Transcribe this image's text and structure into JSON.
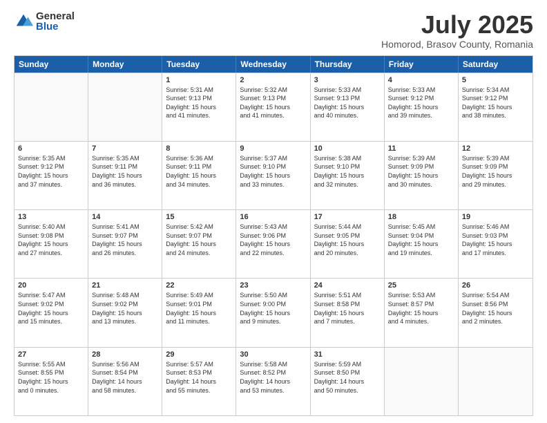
{
  "header": {
    "logo_general": "General",
    "logo_blue": "Blue",
    "title": "July 2025",
    "subtitle": "Homorod, Brasov County, Romania"
  },
  "weekdays": [
    "Sunday",
    "Monday",
    "Tuesday",
    "Wednesday",
    "Thursday",
    "Friday",
    "Saturday"
  ],
  "weeks": [
    [
      {
        "day": "",
        "info": ""
      },
      {
        "day": "",
        "info": ""
      },
      {
        "day": "1",
        "info": "Sunrise: 5:31 AM\nSunset: 9:13 PM\nDaylight: 15 hours\nand 41 minutes."
      },
      {
        "day": "2",
        "info": "Sunrise: 5:32 AM\nSunset: 9:13 PM\nDaylight: 15 hours\nand 41 minutes."
      },
      {
        "day": "3",
        "info": "Sunrise: 5:33 AM\nSunset: 9:13 PM\nDaylight: 15 hours\nand 40 minutes."
      },
      {
        "day": "4",
        "info": "Sunrise: 5:33 AM\nSunset: 9:12 PM\nDaylight: 15 hours\nand 39 minutes."
      },
      {
        "day": "5",
        "info": "Sunrise: 5:34 AM\nSunset: 9:12 PM\nDaylight: 15 hours\nand 38 minutes."
      }
    ],
    [
      {
        "day": "6",
        "info": "Sunrise: 5:35 AM\nSunset: 9:12 PM\nDaylight: 15 hours\nand 37 minutes."
      },
      {
        "day": "7",
        "info": "Sunrise: 5:35 AM\nSunset: 9:11 PM\nDaylight: 15 hours\nand 36 minutes."
      },
      {
        "day": "8",
        "info": "Sunrise: 5:36 AM\nSunset: 9:11 PM\nDaylight: 15 hours\nand 34 minutes."
      },
      {
        "day": "9",
        "info": "Sunrise: 5:37 AM\nSunset: 9:10 PM\nDaylight: 15 hours\nand 33 minutes."
      },
      {
        "day": "10",
        "info": "Sunrise: 5:38 AM\nSunset: 9:10 PM\nDaylight: 15 hours\nand 32 minutes."
      },
      {
        "day": "11",
        "info": "Sunrise: 5:39 AM\nSunset: 9:09 PM\nDaylight: 15 hours\nand 30 minutes."
      },
      {
        "day": "12",
        "info": "Sunrise: 5:39 AM\nSunset: 9:09 PM\nDaylight: 15 hours\nand 29 minutes."
      }
    ],
    [
      {
        "day": "13",
        "info": "Sunrise: 5:40 AM\nSunset: 9:08 PM\nDaylight: 15 hours\nand 27 minutes."
      },
      {
        "day": "14",
        "info": "Sunrise: 5:41 AM\nSunset: 9:07 PM\nDaylight: 15 hours\nand 26 minutes."
      },
      {
        "day": "15",
        "info": "Sunrise: 5:42 AM\nSunset: 9:07 PM\nDaylight: 15 hours\nand 24 minutes."
      },
      {
        "day": "16",
        "info": "Sunrise: 5:43 AM\nSunset: 9:06 PM\nDaylight: 15 hours\nand 22 minutes."
      },
      {
        "day": "17",
        "info": "Sunrise: 5:44 AM\nSunset: 9:05 PM\nDaylight: 15 hours\nand 20 minutes."
      },
      {
        "day": "18",
        "info": "Sunrise: 5:45 AM\nSunset: 9:04 PM\nDaylight: 15 hours\nand 19 minutes."
      },
      {
        "day": "19",
        "info": "Sunrise: 5:46 AM\nSunset: 9:03 PM\nDaylight: 15 hours\nand 17 minutes."
      }
    ],
    [
      {
        "day": "20",
        "info": "Sunrise: 5:47 AM\nSunset: 9:02 PM\nDaylight: 15 hours\nand 15 minutes."
      },
      {
        "day": "21",
        "info": "Sunrise: 5:48 AM\nSunset: 9:02 PM\nDaylight: 15 hours\nand 13 minutes."
      },
      {
        "day": "22",
        "info": "Sunrise: 5:49 AM\nSunset: 9:01 PM\nDaylight: 15 hours\nand 11 minutes."
      },
      {
        "day": "23",
        "info": "Sunrise: 5:50 AM\nSunset: 9:00 PM\nDaylight: 15 hours\nand 9 minutes."
      },
      {
        "day": "24",
        "info": "Sunrise: 5:51 AM\nSunset: 8:58 PM\nDaylight: 15 hours\nand 7 minutes."
      },
      {
        "day": "25",
        "info": "Sunrise: 5:53 AM\nSunset: 8:57 PM\nDaylight: 15 hours\nand 4 minutes."
      },
      {
        "day": "26",
        "info": "Sunrise: 5:54 AM\nSunset: 8:56 PM\nDaylight: 15 hours\nand 2 minutes."
      }
    ],
    [
      {
        "day": "27",
        "info": "Sunrise: 5:55 AM\nSunset: 8:55 PM\nDaylight: 15 hours\nand 0 minutes."
      },
      {
        "day": "28",
        "info": "Sunrise: 5:56 AM\nSunset: 8:54 PM\nDaylight: 14 hours\nand 58 minutes."
      },
      {
        "day": "29",
        "info": "Sunrise: 5:57 AM\nSunset: 8:53 PM\nDaylight: 14 hours\nand 55 minutes."
      },
      {
        "day": "30",
        "info": "Sunrise: 5:58 AM\nSunset: 8:52 PM\nDaylight: 14 hours\nand 53 minutes."
      },
      {
        "day": "31",
        "info": "Sunrise: 5:59 AM\nSunset: 8:50 PM\nDaylight: 14 hours\nand 50 minutes."
      },
      {
        "day": "",
        "info": ""
      },
      {
        "day": "",
        "info": ""
      }
    ]
  ]
}
